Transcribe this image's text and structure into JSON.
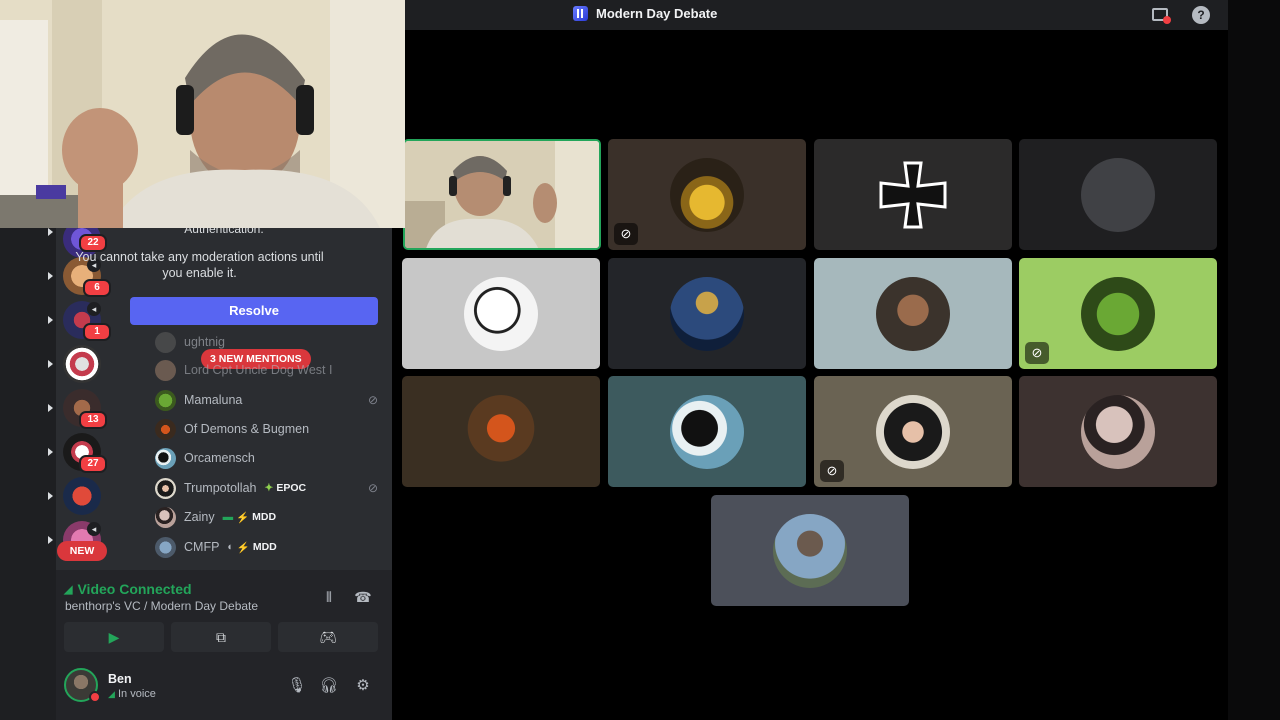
{
  "window": {
    "title": "Modern Day Debate"
  },
  "sidebar": {
    "auth_tail": "Authentication.",
    "auth_message": "You cannot take any moderation actions until you enable it.",
    "resolve_label": "Resolve",
    "mentions_label": "3 NEW MENTIONS",
    "new_label": "NEW",
    "server_badges": [
      "22",
      "6",
      "1",
      "13",
      "27"
    ],
    "members": [
      {
        "name": "ughtnig",
        "tag": "",
        "muted": false
      },
      {
        "name": "Lord Cpt Uncle Dog West I",
        "tag": "",
        "muted": false
      },
      {
        "name": "Mamaluna",
        "tag": "",
        "muted": true
      },
      {
        "name": "Of Demons & Bugmen",
        "tag": "",
        "muted": false
      },
      {
        "name": "Orcamensch",
        "tag": "",
        "muted": false
      },
      {
        "name": "Trumpotollah",
        "tag": "EPOC",
        "muted": true
      },
      {
        "name": "Zainy",
        "tag": "MDD",
        "muted": false
      },
      {
        "name": "CMFP",
        "tag": "MDD",
        "muted": false
      }
    ]
  },
  "voice": {
    "status": "Video Connected",
    "channel": "benthorp's VC / Modern Day Debate"
  },
  "user": {
    "name": "Ben",
    "status": "In voice"
  },
  "colors": {
    "accent": "#5865f2",
    "connected": "#23a55a",
    "danger": "#da373c",
    "speaking": "#23a55a"
  }
}
